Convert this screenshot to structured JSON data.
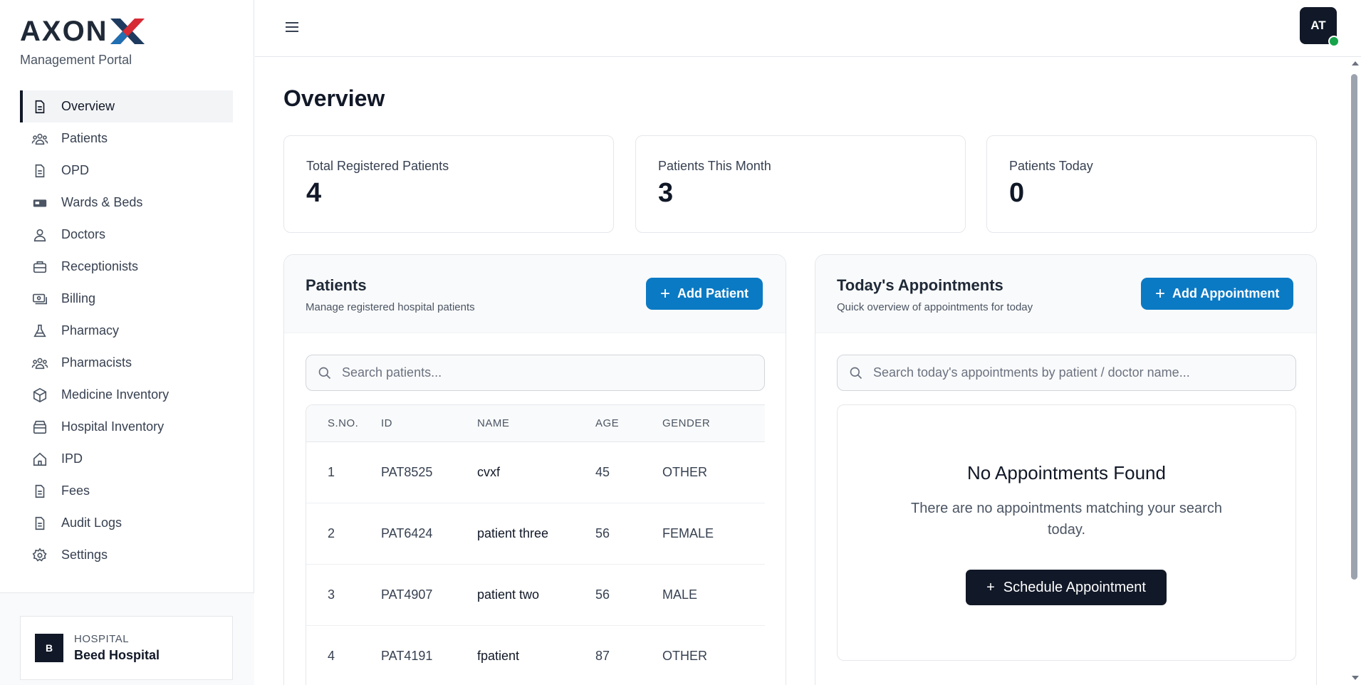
{
  "brand": {
    "logo_main": "AXON",
    "logo_accent": "X",
    "subtitle": "Management Portal"
  },
  "sidebar": {
    "items": [
      {
        "label": "Overview",
        "icon": "document-icon",
        "active": true
      },
      {
        "label": "Patients",
        "icon": "users-icon"
      },
      {
        "label": "OPD",
        "icon": "document-icon"
      },
      {
        "label": "Wards & Beds",
        "icon": "bed-icon"
      },
      {
        "label": "Doctors",
        "icon": "user-icon"
      },
      {
        "label": "Receptionists",
        "icon": "briefcase-icon"
      },
      {
        "label": "Billing",
        "icon": "cash-icon"
      },
      {
        "label": "Pharmacy",
        "icon": "flask-icon"
      },
      {
        "label": "Pharmacists",
        "icon": "users-icon"
      },
      {
        "label": "Medicine Inventory",
        "icon": "cube-icon"
      },
      {
        "label": "Hospital Inventory",
        "icon": "archive-icon"
      },
      {
        "label": "IPD",
        "icon": "home-icon"
      },
      {
        "label": "Fees",
        "icon": "document-icon"
      },
      {
        "label": "Audit Logs",
        "icon": "document-icon"
      },
      {
        "label": "Settings",
        "icon": "gear-icon"
      }
    ],
    "hospital": {
      "badge": "B",
      "kind": "HOSPITAL",
      "name": "Beed Hospital"
    }
  },
  "header": {
    "avatar_initials": "AT"
  },
  "main": {
    "title": "Overview",
    "stats": [
      {
        "label": "Total Registered Patients",
        "value": "4"
      },
      {
        "label": "Patients This Month",
        "value": "3"
      },
      {
        "label": "Patients Today",
        "value": "0"
      }
    ],
    "patients": {
      "title": "Patients",
      "subtitle": "Manage registered hospital patients",
      "add_button": "Add Patient",
      "search_placeholder": "Search patients...",
      "columns": [
        "S.NO.",
        "ID",
        "NAME",
        "AGE",
        "GENDER"
      ],
      "rows": [
        [
          "1",
          "PAT8525",
          "cvxf",
          "45",
          "OTHER"
        ],
        [
          "2",
          "PAT6424",
          "patient three",
          "56",
          "FEMALE"
        ],
        [
          "3",
          "PAT4907",
          "patient two",
          "56",
          "MALE"
        ],
        [
          "4",
          "PAT4191",
          "fpatient",
          "87",
          "OTHER"
        ]
      ]
    },
    "appointments": {
      "title": "Today's Appointments",
      "subtitle": "Quick overview of appointments for today",
      "add_button": "Add Appointment",
      "search_placeholder": "Search today's appointments by patient / doctor name...",
      "empty_title": "No Appointments Found",
      "empty_text": "There are no appointments matching your search today.",
      "schedule_button": "Schedule Appointment"
    }
  },
  "colors": {
    "accent": "#0b7ac4",
    "dark": "#111827",
    "online": "#16a34a"
  }
}
